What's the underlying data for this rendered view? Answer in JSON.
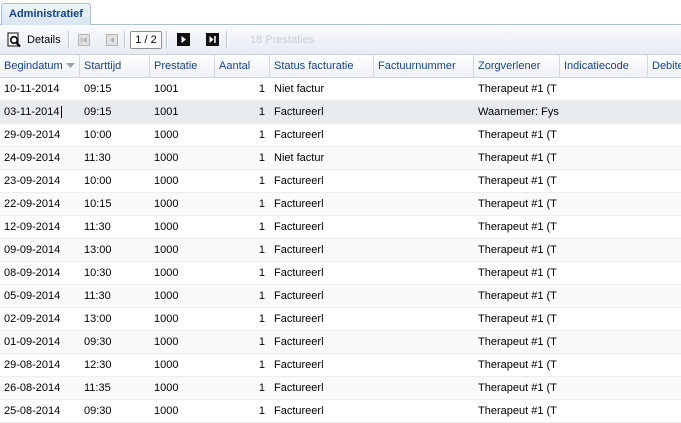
{
  "tabs": {
    "active": "Administratief"
  },
  "toolbar": {
    "details_label": "Details",
    "page": "1 / 2",
    "count_text": "18 Prestaties"
  },
  "columns": [
    "Begindatum",
    "Starttijd",
    "Prestatie",
    "Aantal",
    "Status facturatie",
    "Factuurnummer",
    "Zorgverlener",
    "Indicatiecode",
    "Debite"
  ],
  "rows": [
    {
      "d": "10-11-2014",
      "t": "09:15",
      "p": "1001",
      "a": "1",
      "s": "Niet factur",
      "f": "",
      "z": "Therapeut #1 (T",
      "i": "",
      "db": ""
    },
    {
      "d": "03-11-2014",
      "t": "09:15",
      "p": "1001",
      "a": "1",
      "s": "Factureerl",
      "f": "",
      "z": "Waarnemer: Fys",
      "i": "",
      "db": ""
    },
    {
      "d": "29-09-2014",
      "t": "10:00",
      "p": "1000",
      "a": "1",
      "s": "Factureerl",
      "f": "",
      "z": "Therapeut #1 (T",
      "i": "",
      "db": ""
    },
    {
      "d": "24-09-2014",
      "t": "11:30",
      "p": "1000",
      "a": "1",
      "s": "Niet factur",
      "f": "",
      "z": "Therapeut #1 (T",
      "i": "",
      "db": ""
    },
    {
      "d": "23-09-2014",
      "t": "10:00",
      "p": "1000",
      "a": "1",
      "s": "Factureerl",
      "f": "",
      "z": "Therapeut #1 (T",
      "i": "",
      "db": ""
    },
    {
      "d": "22-09-2014",
      "t": "10:15",
      "p": "1000",
      "a": "1",
      "s": "Factureerl",
      "f": "",
      "z": "Therapeut #1 (T",
      "i": "",
      "db": ""
    },
    {
      "d": "12-09-2014",
      "t": "11:30",
      "p": "1000",
      "a": "1",
      "s": "Factureerl",
      "f": "",
      "z": "Therapeut #1 (T",
      "i": "",
      "db": ""
    },
    {
      "d": "09-09-2014",
      "t": "13:00",
      "p": "1000",
      "a": "1",
      "s": "Factureerl",
      "f": "",
      "z": "Therapeut #1 (T",
      "i": "",
      "db": ""
    },
    {
      "d": "08-09-2014",
      "t": "10:30",
      "p": "1000",
      "a": "1",
      "s": "Factureerl",
      "f": "",
      "z": "Therapeut #1 (T",
      "i": "",
      "db": ""
    },
    {
      "d": "05-09-2014",
      "t": "11:30",
      "p": "1000",
      "a": "1",
      "s": "Factureerl",
      "f": "",
      "z": "Therapeut #1 (T",
      "i": "",
      "db": ""
    },
    {
      "d": "02-09-2014",
      "t": "13:00",
      "p": "1000",
      "a": "1",
      "s": "Factureerl",
      "f": "",
      "z": "Therapeut #1 (T",
      "i": "",
      "db": ""
    },
    {
      "d": "01-09-2014",
      "t": "09:30",
      "p": "1000",
      "a": "1",
      "s": "Factureerl",
      "f": "",
      "z": "Therapeut #1 (T",
      "i": "",
      "db": ""
    },
    {
      "d": "29-08-2014",
      "t": "12:30",
      "p": "1000",
      "a": "1",
      "s": "Factureerl",
      "f": "",
      "z": "Therapeut #1 (T",
      "i": "",
      "db": ""
    },
    {
      "d": "26-08-2014",
      "t": "11:35",
      "p": "1000",
      "a": "1",
      "s": "Factureerl",
      "f": "",
      "z": "Therapeut #1 (T",
      "i": "",
      "db": ""
    },
    {
      "d": "25-08-2014",
      "t": "09:30",
      "p": "1000",
      "a": "1",
      "s": "Factureerl",
      "f": "",
      "z": "Therapeut #1 (T",
      "i": "",
      "db": ""
    }
  ],
  "colors": {
    "header_text": "#15428b",
    "selected_row": "#e8ecef",
    "accent_border": "#a9bfd6"
  }
}
